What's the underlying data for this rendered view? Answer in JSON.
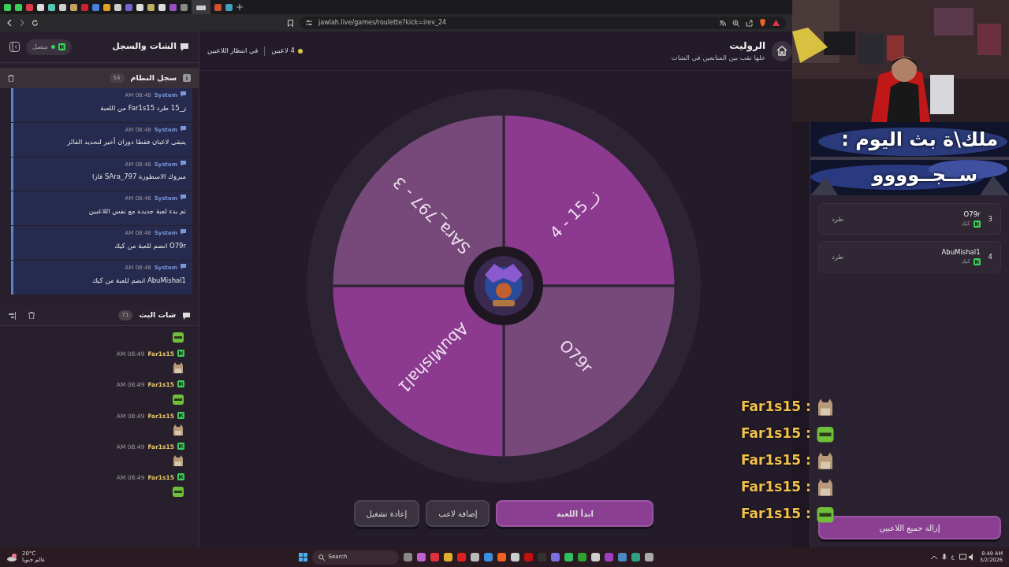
{
  "browser": {
    "url": "jawlah.live/games/roulette?kick=irev_24"
  },
  "chat_panel": {
    "title": "الشات والسجل",
    "connection": "متصل",
    "connected": true,
    "system_log": {
      "title": "سجل النظام",
      "count": "54",
      "messages": [
        {
          "sender": "System",
          "time": "08:48 AM",
          "text": "ز_15 طرد Far1s15 من اللعبة"
        },
        {
          "sender": "System",
          "time": "08:48 AM",
          "text": "يتبقى لاعبان فقطا دوران أخير لتحديد الفائز"
        },
        {
          "sender": "System",
          "time": "08:48 AM",
          "text": "مبروك الاسطورة SAra_797 فازا"
        },
        {
          "sender": "System",
          "time": "08:48 AM",
          "text": "تم بدء لعبة جديدة مع نفس اللاعبين"
        },
        {
          "sender": "System",
          "time": "08:48 AM",
          "text": "O79r انضم للعبة من كيك"
        },
        {
          "sender": "System",
          "time": "08:48 AM",
          "text": "AbuMishal1 انضم للعبة من كيك"
        }
      ]
    },
    "stream_chat": {
      "title": "شات البث",
      "count": "71",
      "messages": [
        {
          "kind": "frog"
        },
        {
          "user": "Far1s15",
          "time": "08:49 AM",
          "kind": "cat"
        },
        {
          "user": "Far1s15",
          "time": "08:49 AM",
          "kind": "frog"
        },
        {
          "user": "Far1s15",
          "time": "08:49 AM",
          "kind": "cat"
        },
        {
          "user": "Far1s15",
          "time": "08:49 AM",
          "kind": "cat"
        },
        {
          "user": "Far1s15",
          "time": "08:49 AM",
          "kind": "frog"
        }
      ]
    }
  },
  "game": {
    "title": "الروليت",
    "subtitle": "خلها تقب بين المتابعين في الشات",
    "players": "4 لاعبين",
    "status": "في انتظار اللاعبين",
    "wheel": {
      "segments": [
        {
          "label": "ز_15 - 4",
          "color": "#8b3a90"
        },
        {
          "label": "O79r",
          "color": "#76497a"
        },
        {
          "label": "AbuMishal1",
          "color": "#8b3a90"
        },
        {
          "label": "SAra_797 - 3",
          "color": "#76497a"
        }
      ]
    },
    "buttons": [
      {
        "label": "ابدأ اللعبة",
        "primary": true
      },
      {
        "label": "إضافة لاعب",
        "primary": false
      },
      {
        "label": "إعادة تشغيل",
        "primary": false
      }
    ]
  },
  "overlay_chat": [
    {
      "user": "Far1s15 :",
      "kind": "cat"
    },
    {
      "user": "Far1s15 :",
      "kind": "frog"
    },
    {
      "user": "Far1s15 :",
      "kind": "cat"
    },
    {
      "user": "Far1s15 :",
      "kind": "cat"
    },
    {
      "user": "Far1s15 :",
      "kind": "frog"
    }
  ],
  "banner": {
    "lines": [
      "ملك\\ة بث اليوم :",
      "ســجــوووو"
    ]
  },
  "players": [
    {
      "number": "3",
      "name": "O79r",
      "platform": "كيك",
      "action": "طرد"
    },
    {
      "number": "4",
      "name": "AbuMishal1",
      "platform": "كيك",
      "action": "طرد"
    }
  ],
  "remove_all": "إزالة جميع اللاعبين",
  "taskbar": {
    "temperature": "20°C",
    "weather": "عالم جنوبا",
    "search": "Search",
    "language": "ع",
    "time": "8:49 AM",
    "date": "3/2/2026"
  }
}
